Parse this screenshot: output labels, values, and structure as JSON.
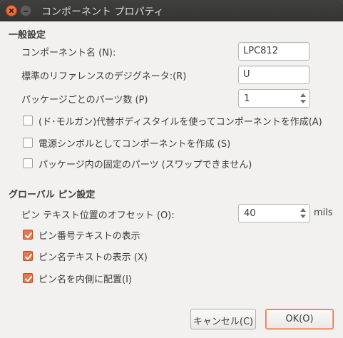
{
  "window": {
    "title": "コンポーネント プロパティ"
  },
  "general": {
    "heading": "一般設定",
    "name_label": "コンポーネント名 (N):",
    "name_value": "LPC812",
    "ref_label": "標準のリファレンスのデジグネータ:(R)",
    "ref_value": "U",
    "parts_label": "パッケージごとのパーツ数 (P)",
    "parts_value": "1",
    "options": [
      {
        "label": "(ド･モルガン)代替ボディスタイルを使ってコンポーネントを作成(A)",
        "checked": false
      },
      {
        "label": "電源シンボルとしてコンポーネントを作成 (S)",
        "checked": false
      },
      {
        "label": "パッケージ内の固定のパーツ (スワップできません)",
        "checked": false
      }
    ]
  },
  "pin": {
    "heading": "グローバル ピン設定",
    "offset_label": "ピン テキスト位置のオフセット (O):",
    "offset_value": "40",
    "offset_unit": "mils",
    "options": [
      {
        "label": "ピン番号テキストの表示",
        "checked": true
      },
      {
        "label": "ピン名テキストの表示 (X)",
        "checked": true
      },
      {
        "label": "ピン名を内側に配置(I)",
        "checked": true
      }
    ]
  },
  "buttons": {
    "cancel": "キャンセル(C)",
    "ok": "OK(O)"
  },
  "colors": {
    "accent": "#e5794c",
    "titlebar": "#3c3c3a",
    "background": "#f2f1f0"
  }
}
